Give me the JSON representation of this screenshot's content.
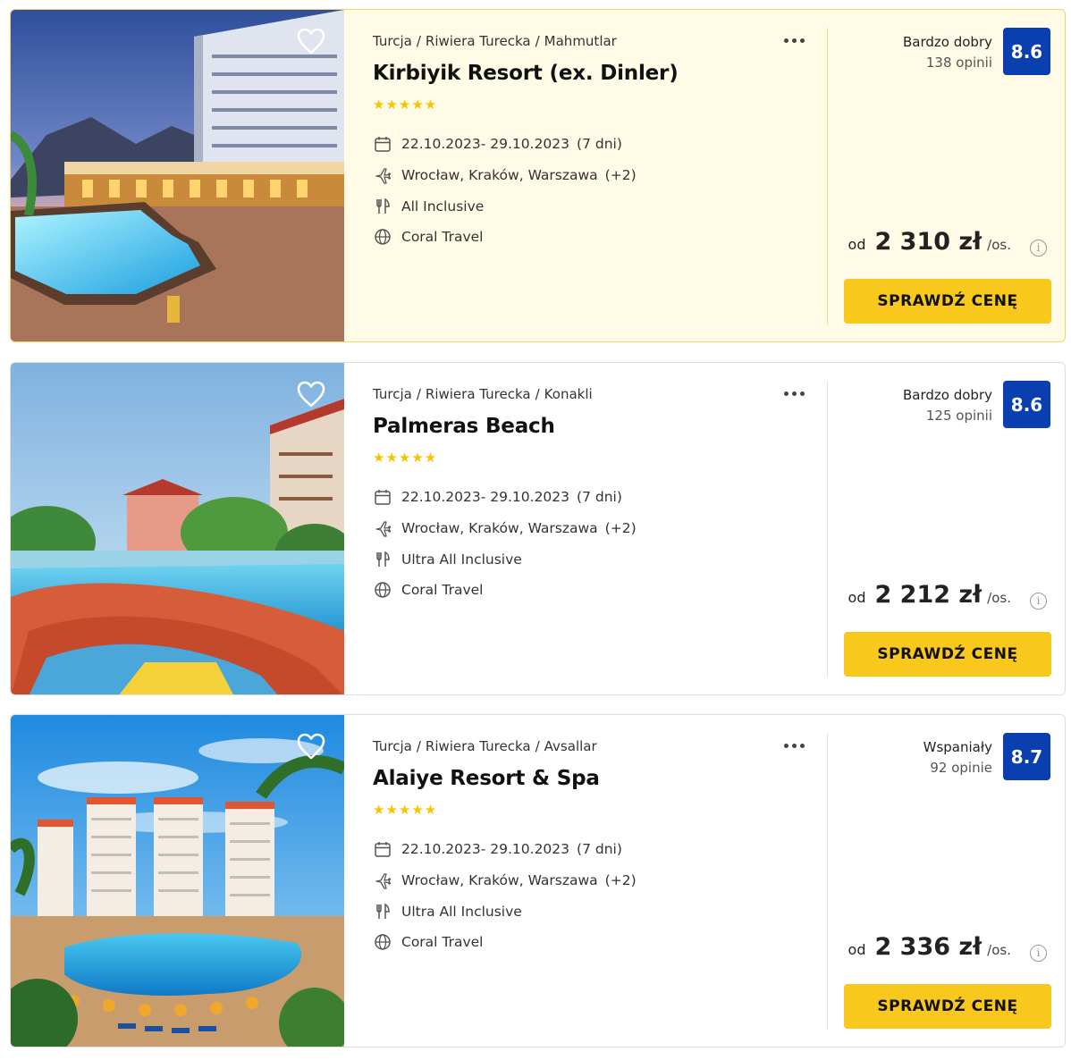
{
  "ui": {
    "bullet_icon": "star-icon",
    "heart_icon": "heart-outline-icon",
    "more_icon": "more-horizontal-icon",
    "info_icon": "info-circle-icon",
    "info_glyph": "i",
    "colors": {
      "accent": "#f8c81c",
      "score_bg": "#0a3fb0",
      "highlight_bg": "#fffbe6",
      "star": "#f6c400"
    }
  },
  "offers": [
    {
      "breadcrumb": [
        "Turcja",
        "Riwiera Turecka",
        "Mahmutlar"
      ],
      "name": "Kirbiyik Resort (ex. Dinler)",
      "stars": "★★★★★",
      "dates": "22.10.2023- 29.10.2023",
      "duration": "(7 dni)",
      "departures": "Wrocław, Kraków, Warszawa",
      "departures_extra": "(+2)",
      "board": "All Inclusive",
      "operator": "Coral Travel",
      "rating_word": "Bardzo dobry",
      "reviews": "138 opinii",
      "score": "8.6",
      "price_prefix": "od",
      "price": "2 310 zł",
      "per_person": "/os.",
      "cta": "SPRAWDŹ CENĘ",
      "highlighted": true,
      "photo": "resort-pool-night-photo"
    },
    {
      "breadcrumb": [
        "Turcja",
        "Riwiera Turecka",
        "Konakli"
      ],
      "name": "Palmeras Beach",
      "stars": "★★★★★",
      "dates": "22.10.2023- 29.10.2023",
      "duration": "(7 dni)",
      "departures": "Wrocław, Kraków, Warszawa",
      "departures_extra": "(+2)",
      "board": "Ultra All Inclusive",
      "operator": "Coral Travel",
      "rating_word": "Bardzo dobry",
      "reviews": "125 opinii",
      "score": "8.6",
      "price_prefix": "od",
      "price": "2 212 zł",
      "per_person": "/os.",
      "cta": "SPRAWDŹ CENĘ",
      "highlighted": false,
      "photo": "waterslide-pool-photo"
    },
    {
      "breadcrumb": [
        "Turcja",
        "Riwiera Turecka",
        "Avsallar"
      ],
      "name": "Alaiye Resort & Spa",
      "stars": "★★★★★",
      "dates": "22.10.2023- 29.10.2023",
      "duration": "(7 dni)",
      "departures": "Wrocław, Kraków, Warszawa",
      "departures_extra": "(+2)",
      "board": "Ultra All Inclusive",
      "operator": "Coral Travel",
      "rating_word": "Wspaniały",
      "reviews": "92 opinie",
      "score": "8.7",
      "price_prefix": "od",
      "price": "2 336 zł",
      "per_person": "/os.",
      "cta": "SPRAWDŹ CENĘ",
      "highlighted": false,
      "photo": "resort-towers-pool-photo"
    }
  ]
}
